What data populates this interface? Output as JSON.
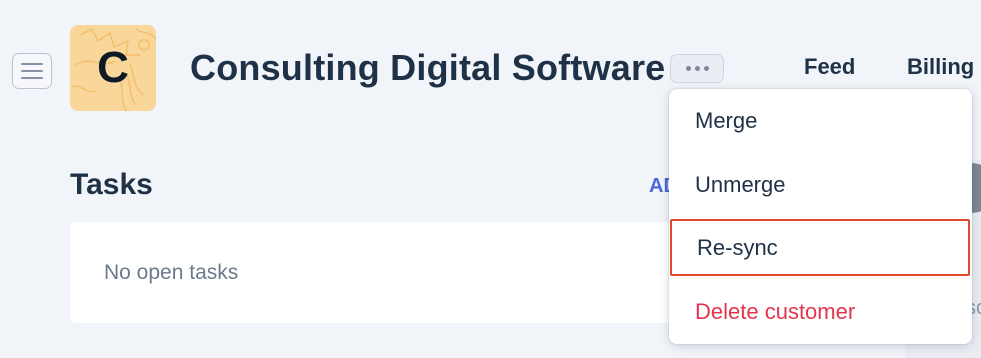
{
  "header": {
    "avatar_letter": "C",
    "title": "Consulting Digital Software",
    "tabs": [
      {
        "label": "Feed"
      },
      {
        "label": "Billing"
      }
    ]
  },
  "tasks": {
    "title": "Tasks",
    "add_label": "ADD",
    "empty_text": "No open tasks"
  },
  "side_panel": {
    "partial_text": "sc"
  },
  "dropdown": {
    "items": [
      {
        "label": "Merge",
        "color": "#1f3147"
      },
      {
        "label": "Unmerge",
        "color": "#1f3147"
      },
      {
        "label": "Re-sync",
        "color": "#1f3147",
        "highlighted": true
      },
      {
        "label": "Delete customer",
        "color": "#e2364f"
      }
    ]
  },
  "colors": {
    "background": "#f1f4f9",
    "avatar_bg": "#f9d69a",
    "accent_link": "#4a68d9",
    "danger": "#e2364f",
    "highlight_border": "#e0492b",
    "title_text": "#1f3147"
  },
  "icons": {
    "menu_toggle": "hamburger-menu-icon",
    "more": "ellipsis-icon"
  }
}
